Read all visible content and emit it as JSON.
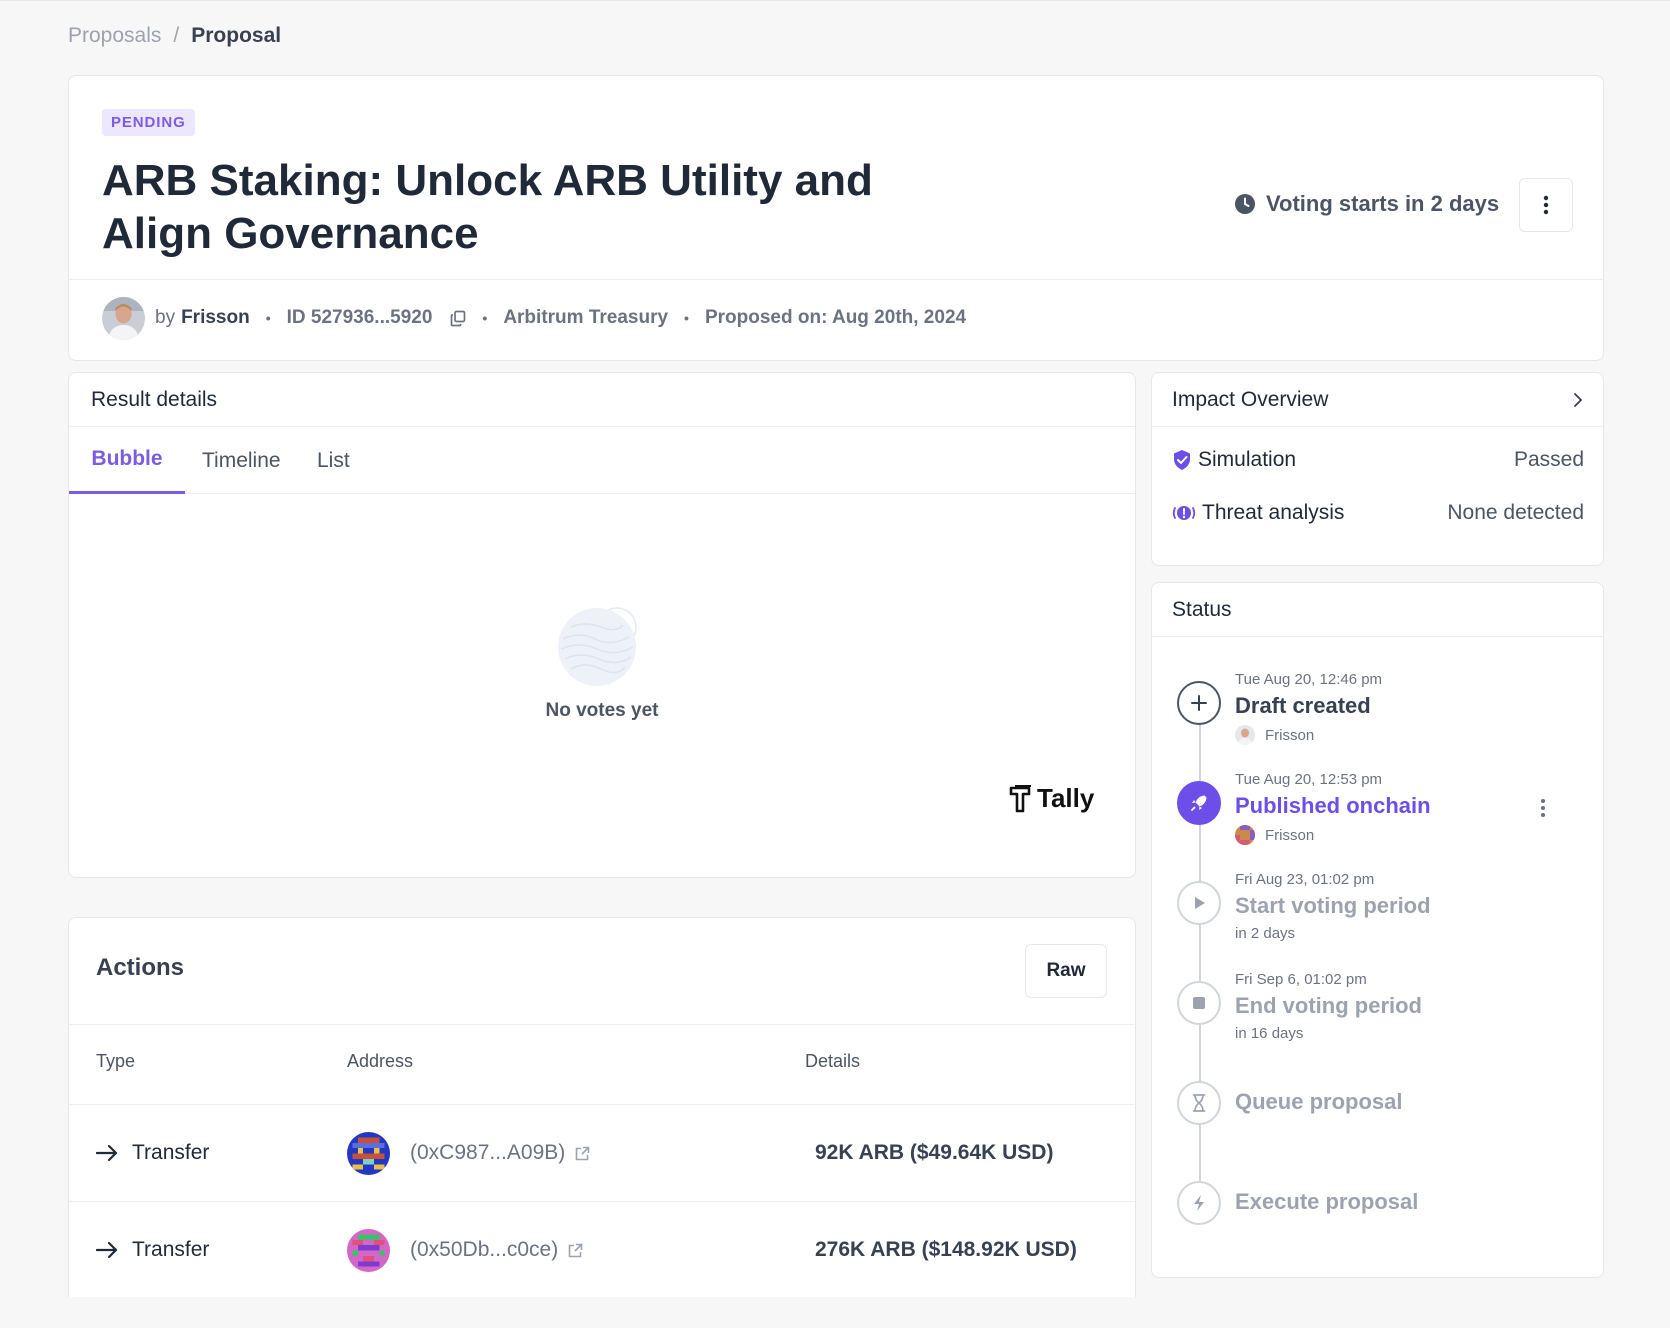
{
  "breadcrumb": {
    "parent": "Proposals",
    "separator": "/",
    "current": "Proposal"
  },
  "proposal": {
    "status_badge": "PENDING",
    "title": "ARB Staking: Unlock ARB Utility and Align Governance",
    "voting_notice": "Voting starts in 2 days",
    "by_label": "by",
    "author": "Frisson",
    "id": "ID 527936...5920",
    "separator": "•",
    "organization": "Arbitrum Treasury",
    "proposed_on": "Proposed on: Aug 20th, 2024"
  },
  "result_details": {
    "heading": "Result details",
    "tabs": [
      {
        "label": "Bubble",
        "active": true
      },
      {
        "label": "Timeline",
        "active": false
      },
      {
        "label": "List",
        "active": false
      }
    ],
    "empty_text": "No votes yet",
    "brand": "Tally"
  },
  "actions": {
    "heading": "Actions",
    "raw_label": "Raw",
    "columns": [
      "Type",
      "Address",
      "Details"
    ],
    "rows": [
      {
        "type": "Transfer",
        "address": "(0xC987...A09B)",
        "details": "92K ARB ($49.64K USD)"
      },
      {
        "type": "Transfer",
        "address": "(0x50Db...c0ce)",
        "details": "276K ARB ($148.92K USD)"
      }
    ]
  },
  "impact": {
    "heading": "Impact Overview",
    "rows": [
      {
        "label": "Simulation",
        "value": "Passed",
        "icon": "shield-check-icon"
      },
      {
        "label": "Threat analysis",
        "value": "None detected",
        "icon": "alert-circle-icon"
      }
    ]
  },
  "status": {
    "heading": "Status",
    "steps": [
      {
        "date": "Tue Aug 20, 12:46 pm",
        "name": "Draft created",
        "sub": "Frisson",
        "state": "done",
        "icon": "plus-icon"
      },
      {
        "date": "Tue Aug 20, 12:53 pm",
        "name": "Published onchain",
        "sub": "Frisson",
        "state": "current",
        "icon": "rocket-icon"
      },
      {
        "date": "Fri Aug 23, 01:02 pm",
        "name": "Start voting period",
        "sub": "in 2 days",
        "state": "upcoming",
        "icon": "play-icon"
      },
      {
        "date": "Fri Sep 6, 01:02 pm",
        "name": "End voting period",
        "sub": "in 16 days",
        "state": "upcoming",
        "icon": "stop-icon"
      },
      {
        "date": "",
        "name": "Queue proposal",
        "sub": "",
        "state": "upcoming",
        "icon": "hourglass-icon"
      },
      {
        "date": "",
        "name": "Execute proposal",
        "sub": "",
        "state": "upcoming",
        "icon": "bolt-icon"
      }
    ]
  },
  "colors": {
    "accent": "#7c5ce0",
    "accent_strong": "#6d4ee8",
    "muted": "#9ca3af",
    "text": "#1f2937"
  }
}
